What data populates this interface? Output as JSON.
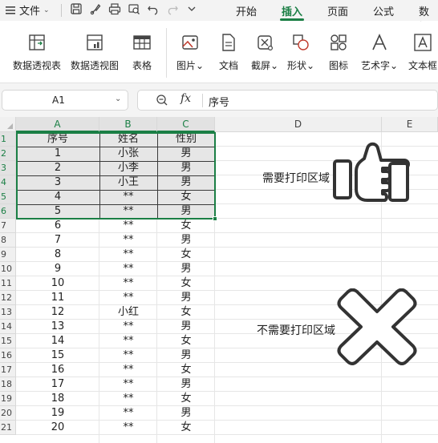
{
  "menubar": {
    "file_label": "文件",
    "tabs": [
      {
        "label": "开始",
        "active": false
      },
      {
        "label": "插入",
        "active": true
      },
      {
        "label": "页面",
        "active": false
      },
      {
        "label": "公式",
        "active": false
      },
      {
        "label": "数据",
        "active": false
      }
    ],
    "quick_icons": [
      "save-icon",
      "brush-icon",
      "print-icon",
      "print-preview-icon",
      "undo-icon",
      "redo-icon",
      "chevron-down-icon"
    ]
  },
  "ribbon": {
    "items": [
      {
        "label": "数据透视表",
        "icon": "pivot-table-icon"
      },
      {
        "label": "数据透视图",
        "icon": "pivot-chart-icon"
      },
      {
        "label": "表格",
        "icon": "table-icon"
      },
      {
        "label": "图片",
        "icon": "picture-icon",
        "dropdown": true
      },
      {
        "label": "文档",
        "icon": "document-icon"
      },
      {
        "label": "截屏",
        "icon": "screenshot-icon",
        "dropdown": true
      },
      {
        "label": "形状",
        "icon": "shapes-icon",
        "dropdown": true
      },
      {
        "label": "图标",
        "icon": "icons-icon"
      },
      {
        "label": "艺术字",
        "icon": "wordart-icon",
        "dropdown": true
      },
      {
        "label": "文本框",
        "icon": "textbox-icon"
      }
    ]
  },
  "formula_bar": {
    "name_box": "A1",
    "fx_label": "fx",
    "value": "序号"
  },
  "grid": {
    "columns": [
      "A",
      "B",
      "C",
      "D",
      "E"
    ],
    "selected_columns": [
      "A",
      "B",
      "C"
    ],
    "row_numbers": [
      "1",
      "2",
      "3",
      "4",
      "5",
      "6",
      "7",
      "8",
      "9",
      "10",
      "11",
      "12",
      "13",
      "14",
      "15",
      "16",
      "17",
      "18",
      "19",
      "20",
      "21"
    ],
    "selected_rows": [
      "1",
      "2",
      "3",
      "4",
      "5",
      "6"
    ],
    "rows": [
      [
        "序号",
        "姓名",
        "性别"
      ],
      [
        "1",
        "小张",
        "男"
      ],
      [
        "2",
        "小李",
        "男"
      ],
      [
        "3",
        "小王",
        "男"
      ],
      [
        "4",
        "**",
        "女"
      ],
      [
        "5",
        "**",
        "男"
      ],
      [
        "6",
        "**",
        "女"
      ],
      [
        "7",
        "**",
        "男"
      ],
      [
        "8",
        "**",
        "女"
      ],
      [
        "9",
        "**",
        "男"
      ],
      [
        "10",
        "**",
        "女"
      ],
      [
        "11",
        "**",
        "男"
      ],
      [
        "12",
        "小红",
        "女"
      ],
      [
        "13",
        "**",
        "男"
      ],
      [
        "14",
        "**",
        "女"
      ],
      [
        "15",
        "**",
        "男"
      ],
      [
        "16",
        "**",
        "女"
      ],
      [
        "17",
        "**",
        "男"
      ],
      [
        "18",
        "**",
        "女"
      ],
      [
        "19",
        "**",
        "男"
      ],
      [
        "20",
        "**",
        "女"
      ]
    ]
  },
  "annotations": {
    "print_area_label": "需要打印区域",
    "pointer_icon": "pointing-hand-icon",
    "no_print_label": "不需要打印区域",
    "cross_icon": "cross-mark-icon"
  },
  "colors": {
    "accent": "#1b7f45",
    "print_area_fill": "#e6e6e6"
  }
}
